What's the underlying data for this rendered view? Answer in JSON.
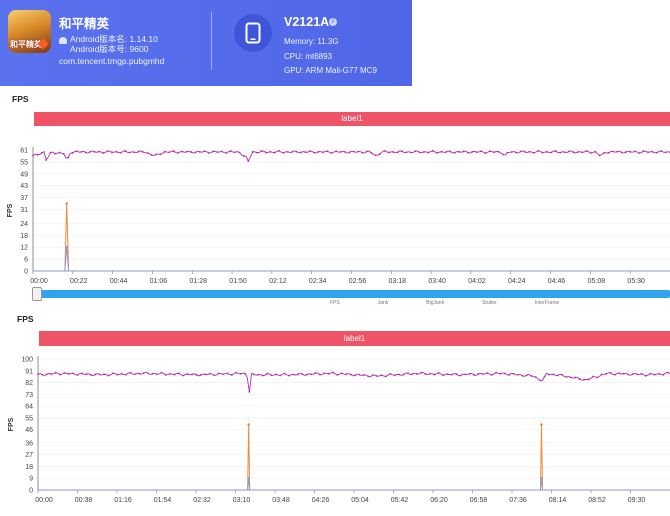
{
  "app": {
    "name": "和平精英",
    "icon_text": "和平精英",
    "version_name": "Android版本名: 1.14.10",
    "version_code": "Android版本号: 9600",
    "package": "com.tencent.tmgp.pubgmhd"
  },
  "device": {
    "name": "V2121A",
    "memory": "Memory: 11.3G",
    "cpu": "CPU: mt6893",
    "gpu": "GPU: ARM Mali-G77 MC9"
  },
  "panel1": {
    "title": "FPS",
    "label": "label1"
  },
  "panel2": {
    "title": "FPS",
    "label": "label1"
  },
  "legend": [
    "FPS",
    "Jank",
    "BigJank",
    "Stutter",
    "InterFrame"
  ],
  "colors": {
    "fps": "#b42bb0",
    "jank": "#f08a3c",
    "bigjank": "#8a9ad8",
    "label_bar": "#ef5366",
    "scrollbar": "#2fa3ee",
    "header": "#5a72ee"
  },
  "chart_data": [
    {
      "type": "line",
      "title": "",
      "ylabel": "FPS",
      "ylim": [
        0,
        61
      ],
      "y_ticks": [
        "0",
        "6",
        "12",
        "18",
        "24",
        "31",
        "37",
        "43",
        "49",
        "55",
        "61"
      ],
      "x_ticks": [
        "00:00",
        "00:22",
        "00:44",
        "01:06",
        "01:28",
        "01:50",
        "02:12",
        "02:34",
        "02:56",
        "03:18",
        "03:40",
        "04:02",
        "04:24",
        "04:46",
        "05:08",
        "05:30"
      ],
      "duration_s": 340,
      "series": [
        {
          "name": "FPS",
          "baseline": 60,
          "points": [
            [
              0,
              58
            ],
            [
              3,
              59
            ],
            [
              6,
              60
            ],
            [
              7,
              56
            ],
            [
              10,
              60
            ],
            [
              17,
              59
            ],
            [
              18,
              55
            ],
            [
              20,
              60
            ],
            [
              60,
              60
            ],
            [
              65,
              58
            ],
            [
              70,
              60
            ],
            [
              110,
              60
            ],
            [
              114,
              57
            ],
            [
              115,
              55
            ],
            [
              117,
              60
            ],
            [
              180,
              60
            ],
            [
              183,
              58
            ],
            [
              186,
              60
            ],
            [
              250,
              60
            ],
            [
              252,
              58
            ],
            [
              254,
              60
            ],
            [
              300,
              60
            ],
            [
              303,
              58
            ],
            [
              306,
              60
            ],
            [
              340,
              60
            ]
          ]
        },
        {
          "name": "Jank",
          "points": [
            [
              0,
              0
            ],
            [
              17,
              0
            ],
            [
              18,
              34
            ],
            [
              19,
              0
            ],
            [
              340,
              0
            ]
          ]
        },
        {
          "name": "BigJank",
          "points": [
            [
              0,
              0
            ],
            [
              17,
              0
            ],
            [
              18,
              12
            ],
            [
              19,
              0
            ],
            [
              340,
              0
            ]
          ]
        }
      ]
    },
    {
      "type": "line",
      "title": "",
      "ylabel": "FPS",
      "ylim": [
        0,
        100
      ],
      "y_ticks": [
        "0",
        "9",
        "18",
        "27",
        "36",
        "46",
        "55",
        "64",
        "73",
        "82",
        "91",
        "100"
      ],
      "x_ticks": [
        "00:00",
        "00:38",
        "01:16",
        "01:54",
        "02:32",
        "03:10",
        "03:48",
        "04:26",
        "05:04",
        "05:42",
        "06:20",
        "06:58",
        "07:36",
        "08:14",
        "08:52",
        "09:30"
      ],
      "duration_s": 600,
      "series": [
        {
          "name": "FPS",
          "baseline": 89,
          "points": [
            [
              0,
              88
            ],
            [
              20,
              89
            ],
            [
              60,
              88
            ],
            [
              100,
              89
            ],
            [
              150,
              88
            ],
            [
              198,
              89
            ],
            [
              200,
              82
            ],
            [
              201,
              72
            ],
            [
              202,
              88
            ],
            [
              240,
              88
            ],
            [
              280,
              89
            ],
            [
              320,
              87
            ],
            [
              360,
              89
            ],
            [
              400,
              88
            ],
            [
              440,
              89
            ],
            [
              470,
              87
            ],
            [
              480,
              83
            ],
            [
              482,
              89
            ],
            [
              500,
              87
            ],
            [
              520,
              84
            ],
            [
              540,
              89
            ],
            [
              580,
              88
            ],
            [
              600,
              89
            ]
          ]
        },
        {
          "name": "Jank",
          "points": [
            [
              0,
              0
            ],
            [
              199,
              0
            ],
            [
              200,
              50
            ],
            [
              201,
              0
            ],
            [
              477,
              0
            ],
            [
              478,
              50
            ],
            [
              479,
              0
            ],
            [
              600,
              0
            ]
          ]
        },
        {
          "name": "BigJank",
          "points": [
            [
              0,
              0
            ],
            [
              199,
              0
            ],
            [
              200,
              9
            ],
            [
              201,
              0
            ],
            [
              477,
              0
            ],
            [
              478,
              9
            ],
            [
              479,
              0
            ],
            [
              600,
              0
            ]
          ]
        }
      ]
    }
  ]
}
